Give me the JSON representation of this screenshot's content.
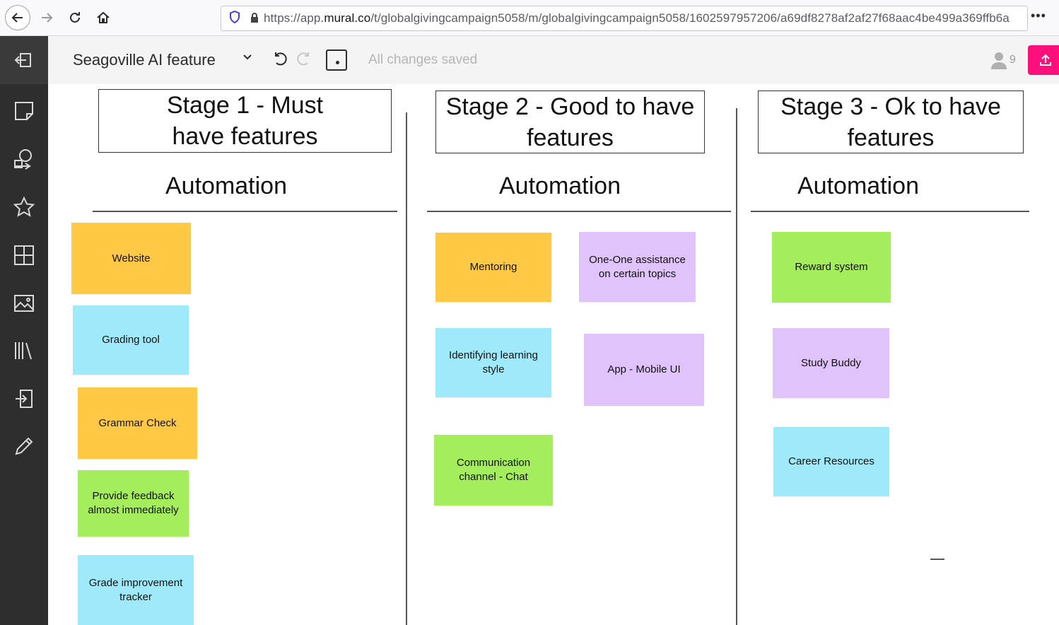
{
  "browser": {
    "url_prefix": "https://app.",
    "url_domain": "mural.co",
    "url_path": "/t/globalgivingcampaign5058/m/globalgivingcampaign5058/1602597957206/a69df8278af2af27f68aac4be499a369ffb6a",
    "more_label": "•••"
  },
  "header": {
    "title": "Seagoville AI feature",
    "save_status": "All changes saved",
    "user_count": "9"
  },
  "colors": {
    "orange": "#ffc845",
    "blue": "#9eeafa",
    "green": "#a4ed5b",
    "purple": "#e0c3fa",
    "share": "#ff0f7b"
  },
  "stages": [
    {
      "title": "Stage 1 - Must have features",
      "heading": "Automation"
    },
    {
      "title": "Stage 2 - Good to have features",
      "heading": "Automation"
    },
    {
      "title": "Stage 3 - Ok to have features",
      "heading": "Automation"
    }
  ],
  "stickies": {
    "stage1": [
      "Website",
      "Grading tool",
      "Grammar Check",
      "Provide feedback almost immediately",
      "Grade improvement tracker"
    ],
    "stage2": [
      "Mentoring",
      "One-One assistance on certain topics",
      "Identifying learning style",
      "App - Mobile UI",
      "Communication channel - Chat"
    ],
    "stage3": [
      "Reward system",
      "Study Buddy",
      "Career Resources"
    ]
  },
  "icons": {
    "back": "arrow-left-icon",
    "forward": "arrow-right-icon",
    "reload": "reload-icon",
    "home": "home-icon",
    "shield": "shield-icon",
    "lock": "lock-icon",
    "undo": "undo-icon",
    "redo": "redo-icon",
    "user": "user-icon",
    "share": "upload-icon"
  }
}
